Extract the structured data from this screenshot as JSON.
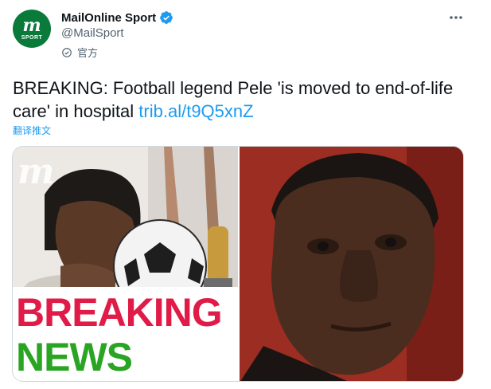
{
  "account": {
    "display_name": "MailOnline Sport",
    "handle": "@MailSport",
    "official_label": "官方",
    "avatar_logo_letter": "m",
    "avatar_logo_sub": "SPORT",
    "verified_icon": "verified-badge-icon",
    "official_icon": "official-check-icon"
  },
  "menu": {
    "more_icon": "more-options-icon"
  },
  "tweet": {
    "text": "BREAKING: Football legend Pele 'is moved to end-of-life care' in hospital ",
    "link": "trib.al/t9Q5xnZ",
    "translate_label": "翻译推文"
  },
  "media": {
    "left_watermark": "m",
    "breaking_word": "BREAKING",
    "news_word": "NEWS"
  },
  "colors": {
    "link": "#1d9bf0",
    "avatar_bg": "#0a7a3b",
    "breaking_red": "#e01b47",
    "news_green": "#2aa523",
    "secondary_text": "#536471"
  }
}
